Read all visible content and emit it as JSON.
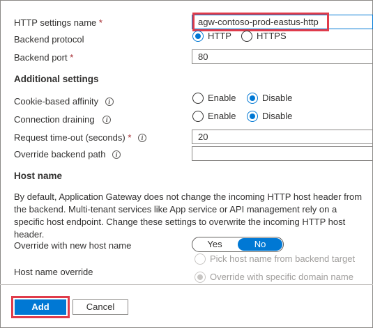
{
  "form": {
    "http_settings_name": {
      "label": "HTTP settings name",
      "required": "*",
      "value": "agw-contoso-prod-eastus-http"
    },
    "backend_protocol": {
      "label": "Backend protocol",
      "options": [
        "HTTP",
        "HTTPS"
      ],
      "selected": "HTTP"
    },
    "backend_port": {
      "label": "Backend port",
      "required": "*",
      "value": "80"
    }
  },
  "additional": {
    "title": "Additional settings",
    "cookie_affinity": {
      "label": "Cookie-based affinity",
      "options": [
        "Enable",
        "Disable"
      ],
      "selected": "Disable"
    },
    "connection_draining": {
      "label": "Connection draining",
      "options": [
        "Enable",
        "Disable"
      ],
      "selected": "Disable"
    },
    "request_timeout": {
      "label": "Request time-out (seconds)",
      "required": "*",
      "value": "20"
    },
    "override_path": {
      "label": "Override backend path",
      "value": ""
    }
  },
  "host": {
    "title": "Host name",
    "description": "By default, Application Gateway does not change the incoming HTTP host header from the backend. Multi-tenant services like App service or API management rely on a specific host endpoint. Change these settings to overwrite the incoming HTTP host header.",
    "override_new": {
      "label": "Override with new host name",
      "options": [
        "Yes",
        "No"
      ],
      "selected": "No"
    },
    "host_override": {
      "label": "Host name override",
      "options": [
        "Pick host name from backend target",
        "Override with specific domain name"
      ],
      "selected": "Override with specific domain name"
    }
  },
  "footer": {
    "add_label": "Add",
    "cancel_label": "Cancel"
  },
  "info_glyph": "i",
  "colors": {
    "accent": "#0078d4",
    "highlight": "#e03c4b",
    "required": "#a4262c"
  }
}
